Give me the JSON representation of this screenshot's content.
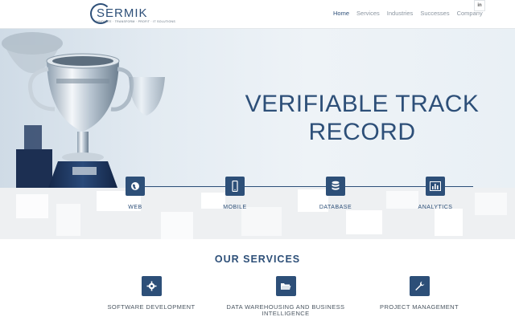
{
  "logo": {
    "name": "SERMIK",
    "tagline": "INNOVATE · TRANSFORM · PROFIT · IT SOLUTIONS"
  },
  "nav": {
    "items": [
      {
        "label": "Home",
        "active": true
      },
      {
        "label": "Services",
        "active": false
      },
      {
        "label": "Industries",
        "active": false
      },
      {
        "label": "Successes",
        "active": false
      },
      {
        "label": "Company",
        "active": false
      }
    ],
    "social": "in"
  },
  "hero": {
    "title_line1": "VERIFIABLE TRACK",
    "title_line2": "RECORD"
  },
  "features": [
    {
      "label": "WEB",
      "icon": "globe-icon"
    },
    {
      "label": "MOBILE",
      "icon": "mobile-icon"
    },
    {
      "label": "DATABASE",
      "icon": "database-icon"
    },
    {
      "label": "ANALYTICS",
      "icon": "chart-icon"
    }
  ],
  "services": {
    "title": "OUR SERVICES",
    "items": [
      {
        "label": "SOFTWARE DEVELOPMENT",
        "icon": "gear-icon"
      },
      {
        "label_line1": "DATA WAREHOUSING AND BUSINESS",
        "label_line2": "INTELLIGENCE",
        "icon": "folder-icon"
      },
      {
        "label": "PROJECT MANAGEMENT",
        "icon": "wrench-icon"
      }
    ]
  },
  "colors": {
    "brand": "#2d4f78",
    "nav_inactive": "#8b95a0",
    "strip_bg": "#f2f3f5"
  }
}
